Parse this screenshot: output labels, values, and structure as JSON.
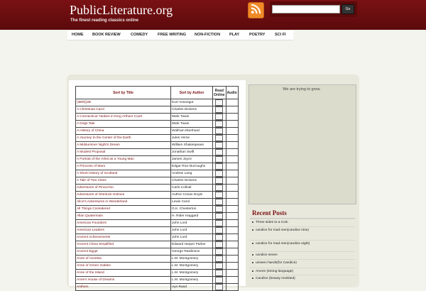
{
  "site": {
    "title": "PublicLiterature.org",
    "tagline": "The finest reading classics online"
  },
  "search": {
    "button_label": "Go",
    "value": ""
  },
  "icons": {
    "rss": "rss-icon",
    "read": "book-icon"
  },
  "colors": {
    "header": "#6e0d10",
    "accent": "#7a1114",
    "rss": "#ef8a27"
  },
  "nav": {
    "items": [
      {
        "label": "HOME"
      },
      {
        "label": "BOOK REVIEW"
      },
      {
        "label": "COMEDY"
      },
      {
        "label": "FREE WRITING"
      },
      {
        "label": "NON-FICTION"
      },
      {
        "label": "PLAY"
      },
      {
        "label": "POETRY"
      },
      {
        "label": "SCI FI"
      }
    ]
  },
  "table": {
    "headers": {
      "title": "Sort by Title",
      "author": "Sort by Author",
      "read": "Read Online",
      "audio": "Audio"
    },
    "rows": [
      {
        "title": "(3BR)(2B",
        "author": "Kurt Vonnegut"
      },
      {
        "title": "A Christmas Carol",
        "author": "Charles Dickens"
      },
      {
        "title": "A Connecticut Yankee in King Arthurs Court",
        "author": "Mark Twain"
      },
      {
        "title": "A Dogs Tale",
        "author": "Mark Twain"
      },
      {
        "title": "A History of China",
        "author": "Wolfram Eberhard"
      },
      {
        "title": "A Journey to the Center of the Earth",
        "author": "Jules Verne"
      },
      {
        "title": "A Midsummer Night's Dream",
        "author": "William Shakespeare"
      },
      {
        "title": "A Modest Proposal",
        "author": "Jonathan Swift"
      },
      {
        "title": "A Portrait of the Artist as a Young Man",
        "author": "James Joyce"
      },
      {
        "title": "A Princess of Mars",
        "author": "Edgar Rice Burroughs"
      },
      {
        "title": "A Short History of Scotland",
        "author": "Andrew Lang"
      },
      {
        "title": "A Tale of Two Cities",
        "author": "Charles Dickens"
      },
      {
        "title": "Adventures of Pinocchio",
        "author": "Carlo Collodi"
      },
      {
        "title": "Adventures of Sherlock Holmes",
        "author": "Author Conan Doyle"
      },
      {
        "title": "Alice's Adventures in Wonderland",
        "author": "Lewis Carol"
      },
      {
        "title": "All Things Considered",
        "author": "G.K. Chesterton"
      },
      {
        "title": "Allan Quatermain",
        "author": "H. Rider Haggard"
      },
      {
        "title": "American Founders",
        "author": "John Lord"
      },
      {
        "title": "American Leaders",
        "author": "John Lord"
      },
      {
        "title": "Ancient Achievements",
        "author": "John Lord"
      },
      {
        "title": "Ancient China Simplified",
        "author": "Edward Harper Parker"
      },
      {
        "title": "Ancient Egypt",
        "author": "George Rawlinson"
      },
      {
        "title": "Anne of Avonlea",
        "author": "L.M. Montgomery"
      },
      {
        "title": "Anne of Green Gables",
        "author": "L.M. Montgomery"
      },
      {
        "title": "Anne of the Island",
        "author": "L.M. Montgomery"
      },
      {
        "title": "Anne's House of Dreams",
        "author": "L.M. Montgomery"
      },
      {
        "title": "Anthem",
        "author": "Ayn Rand"
      }
    ]
  },
  "sidebar": {
    "note": "We are trying to grow.",
    "recent_title": "Recent Posts",
    "recent_posts": [
      {
        "label": "Three sides to a Coin"
      },
      {
        "label": "candice for mad men(candice nine)"
      },
      {
        "label": "candice for mad men(candice eight)"
      },
      {
        "label": "candice seven"
      },
      {
        "label": "unseen hands(for Candice)"
      },
      {
        "label": "Amore (strong language)"
      },
      {
        "label": "Candice (beauty revisited)"
      }
    ]
  }
}
